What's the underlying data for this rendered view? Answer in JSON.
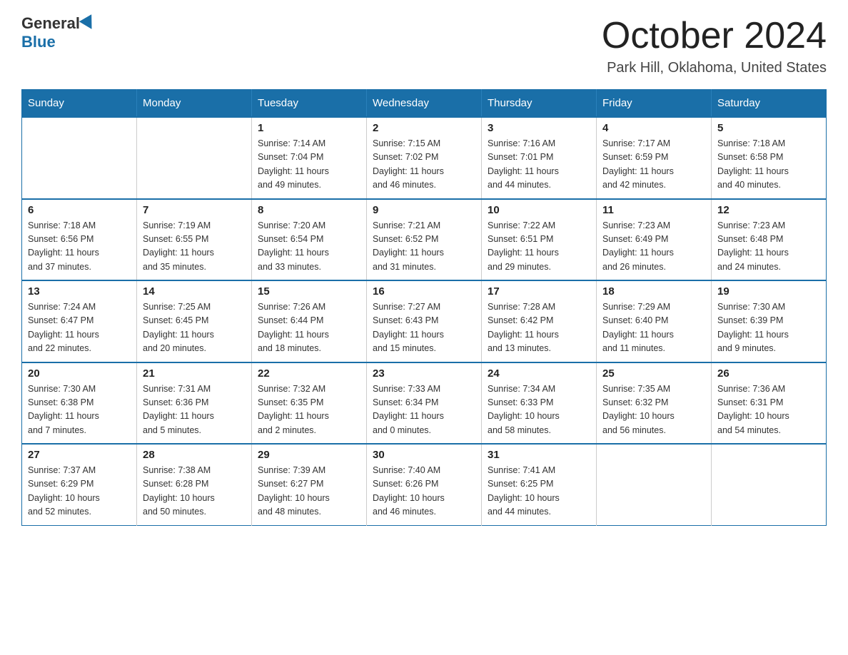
{
  "header": {
    "logo_general": "General",
    "logo_blue": "Blue",
    "month_title": "October 2024",
    "location": "Park Hill, Oklahoma, United States"
  },
  "days_of_week": [
    "Sunday",
    "Monday",
    "Tuesday",
    "Wednesday",
    "Thursday",
    "Friday",
    "Saturday"
  ],
  "weeks": [
    [
      {
        "day": "",
        "info": ""
      },
      {
        "day": "",
        "info": ""
      },
      {
        "day": "1",
        "info": "Sunrise: 7:14 AM\nSunset: 7:04 PM\nDaylight: 11 hours\nand 49 minutes."
      },
      {
        "day": "2",
        "info": "Sunrise: 7:15 AM\nSunset: 7:02 PM\nDaylight: 11 hours\nand 46 minutes."
      },
      {
        "day": "3",
        "info": "Sunrise: 7:16 AM\nSunset: 7:01 PM\nDaylight: 11 hours\nand 44 minutes."
      },
      {
        "day": "4",
        "info": "Sunrise: 7:17 AM\nSunset: 6:59 PM\nDaylight: 11 hours\nand 42 minutes."
      },
      {
        "day": "5",
        "info": "Sunrise: 7:18 AM\nSunset: 6:58 PM\nDaylight: 11 hours\nand 40 minutes."
      }
    ],
    [
      {
        "day": "6",
        "info": "Sunrise: 7:18 AM\nSunset: 6:56 PM\nDaylight: 11 hours\nand 37 minutes."
      },
      {
        "day": "7",
        "info": "Sunrise: 7:19 AM\nSunset: 6:55 PM\nDaylight: 11 hours\nand 35 minutes."
      },
      {
        "day": "8",
        "info": "Sunrise: 7:20 AM\nSunset: 6:54 PM\nDaylight: 11 hours\nand 33 minutes."
      },
      {
        "day": "9",
        "info": "Sunrise: 7:21 AM\nSunset: 6:52 PM\nDaylight: 11 hours\nand 31 minutes."
      },
      {
        "day": "10",
        "info": "Sunrise: 7:22 AM\nSunset: 6:51 PM\nDaylight: 11 hours\nand 29 minutes."
      },
      {
        "day": "11",
        "info": "Sunrise: 7:23 AM\nSunset: 6:49 PM\nDaylight: 11 hours\nand 26 minutes."
      },
      {
        "day": "12",
        "info": "Sunrise: 7:23 AM\nSunset: 6:48 PM\nDaylight: 11 hours\nand 24 minutes."
      }
    ],
    [
      {
        "day": "13",
        "info": "Sunrise: 7:24 AM\nSunset: 6:47 PM\nDaylight: 11 hours\nand 22 minutes."
      },
      {
        "day": "14",
        "info": "Sunrise: 7:25 AM\nSunset: 6:45 PM\nDaylight: 11 hours\nand 20 minutes."
      },
      {
        "day": "15",
        "info": "Sunrise: 7:26 AM\nSunset: 6:44 PM\nDaylight: 11 hours\nand 18 minutes."
      },
      {
        "day": "16",
        "info": "Sunrise: 7:27 AM\nSunset: 6:43 PM\nDaylight: 11 hours\nand 15 minutes."
      },
      {
        "day": "17",
        "info": "Sunrise: 7:28 AM\nSunset: 6:42 PM\nDaylight: 11 hours\nand 13 minutes."
      },
      {
        "day": "18",
        "info": "Sunrise: 7:29 AM\nSunset: 6:40 PM\nDaylight: 11 hours\nand 11 minutes."
      },
      {
        "day": "19",
        "info": "Sunrise: 7:30 AM\nSunset: 6:39 PM\nDaylight: 11 hours\nand 9 minutes."
      }
    ],
    [
      {
        "day": "20",
        "info": "Sunrise: 7:30 AM\nSunset: 6:38 PM\nDaylight: 11 hours\nand 7 minutes."
      },
      {
        "day": "21",
        "info": "Sunrise: 7:31 AM\nSunset: 6:36 PM\nDaylight: 11 hours\nand 5 minutes."
      },
      {
        "day": "22",
        "info": "Sunrise: 7:32 AM\nSunset: 6:35 PM\nDaylight: 11 hours\nand 2 minutes."
      },
      {
        "day": "23",
        "info": "Sunrise: 7:33 AM\nSunset: 6:34 PM\nDaylight: 11 hours\nand 0 minutes."
      },
      {
        "day": "24",
        "info": "Sunrise: 7:34 AM\nSunset: 6:33 PM\nDaylight: 10 hours\nand 58 minutes."
      },
      {
        "day": "25",
        "info": "Sunrise: 7:35 AM\nSunset: 6:32 PM\nDaylight: 10 hours\nand 56 minutes."
      },
      {
        "day": "26",
        "info": "Sunrise: 7:36 AM\nSunset: 6:31 PM\nDaylight: 10 hours\nand 54 minutes."
      }
    ],
    [
      {
        "day": "27",
        "info": "Sunrise: 7:37 AM\nSunset: 6:29 PM\nDaylight: 10 hours\nand 52 minutes."
      },
      {
        "day": "28",
        "info": "Sunrise: 7:38 AM\nSunset: 6:28 PM\nDaylight: 10 hours\nand 50 minutes."
      },
      {
        "day": "29",
        "info": "Sunrise: 7:39 AM\nSunset: 6:27 PM\nDaylight: 10 hours\nand 48 minutes."
      },
      {
        "day": "30",
        "info": "Sunrise: 7:40 AM\nSunset: 6:26 PM\nDaylight: 10 hours\nand 46 minutes."
      },
      {
        "day": "31",
        "info": "Sunrise: 7:41 AM\nSunset: 6:25 PM\nDaylight: 10 hours\nand 44 minutes."
      },
      {
        "day": "",
        "info": ""
      },
      {
        "day": "",
        "info": ""
      }
    ]
  ]
}
